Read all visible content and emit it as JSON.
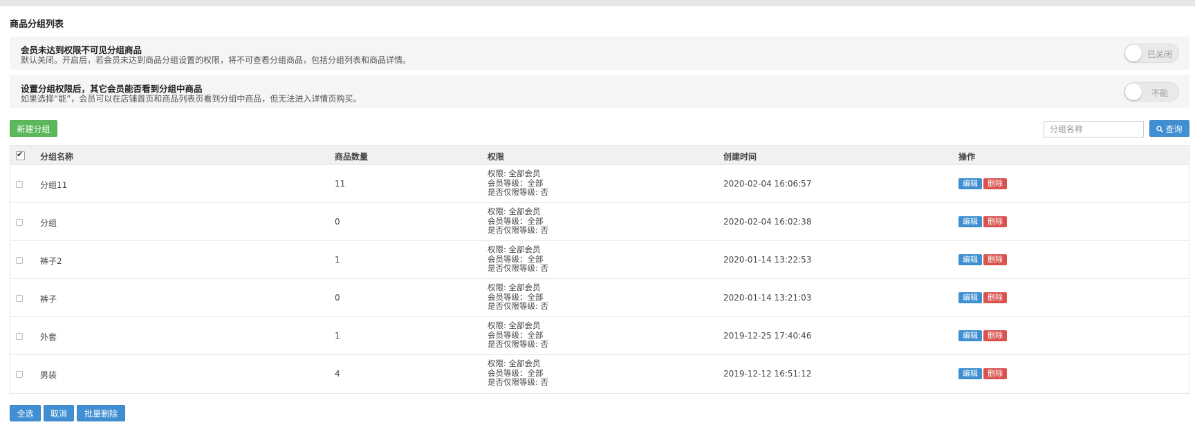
{
  "page": {
    "title": "商品分组列表"
  },
  "settings": [
    {
      "title": "会员未达到权限不可见分组商品",
      "desc": "默认关闭。开启后，若会员未达到商品分组设置的权限，将不可查看分组商品，包括分组列表和商品详情。",
      "toggle_label": "已关闭"
    },
    {
      "title": "设置分组权限后，其它会员能否看到分组中商品",
      "desc": "如果选择“能”，会员可以在店铺首页和商品列表页看到分组中商品，但无法进入详情页购买。",
      "toggle_label": "不能"
    }
  ],
  "toolbar": {
    "new_group": "新建分组",
    "search_placeholder": "分组名称",
    "search_button": "查询"
  },
  "table": {
    "headers": {
      "name": "分组名称",
      "count": "商品数量",
      "perm": "权限",
      "time": "创建时间",
      "ops": "操作"
    },
    "rows": [
      {
        "name": "分组11",
        "count": "11",
        "perm1": "权限: 全部会员",
        "perm2": "会员等级：全部",
        "perm3": "是否仅限等级: 否",
        "time": "2020-02-04 16:06:57"
      },
      {
        "name": "分组",
        "count": "0",
        "perm1": "权限: 全部会员",
        "perm2": "会员等级：全部",
        "perm3": "是否仅限等级: 否",
        "time": "2020-02-04 16:02:38"
      },
      {
        "name": "裤子2",
        "count": "1",
        "perm1": "权限: 全部会员",
        "perm2": "会员等级：全部",
        "perm3": "是否仅限等级: 否",
        "time": "2020-01-14 13:22:53"
      },
      {
        "name": "裤子",
        "count": "0",
        "perm1": "权限: 全部会员",
        "perm2": "会员等级：全部",
        "perm3": "是否仅限等级: 否",
        "time": "2020-01-14 13:21:03"
      },
      {
        "name": "外套",
        "count": "1",
        "perm1": "权限: 全部会员",
        "perm2": "会员等级：全部",
        "perm3": "是否仅限等级: 否",
        "time": "2019-12-25 17:40:46"
      },
      {
        "name": "男装",
        "count": "4",
        "perm1": "权限: 全部会员",
        "perm2": "会员等级：全部",
        "perm3": "是否仅限等级: 否",
        "time": "2019-12-12 16:51:12"
      }
    ],
    "edit_label": "编辑",
    "delete_label": "删除"
  },
  "bulk": {
    "select_all": "全选",
    "cancel": "取消",
    "batch_delete": "批量删除"
  },
  "colors": {
    "green": "#5cb85c",
    "blue": "#3f8fd2",
    "red": "#d9534f"
  },
  "icons": {
    "search": "search-icon",
    "select_all_checkbox": "checkbox-checked-icon"
  }
}
